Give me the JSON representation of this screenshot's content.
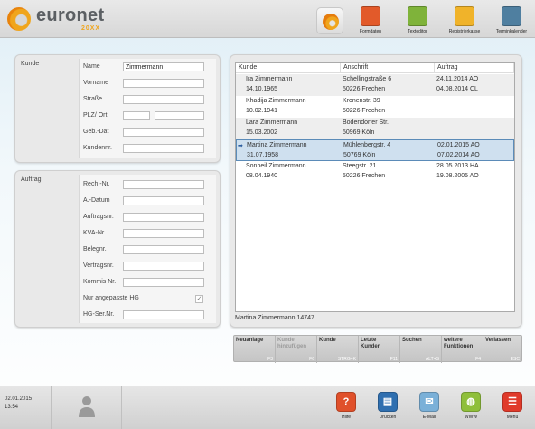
{
  "app": {
    "brand": "euronet",
    "brand_sub": "20XX"
  },
  "toolbar": [
    {
      "label": "Formdaten",
      "icon": "glasses-icon",
      "color": "#e25a2a"
    },
    {
      "label": "Texteditor",
      "icon": "pencil-icon",
      "color": "#7fb33a"
    },
    {
      "label": "Registrierkasse",
      "icon": "cash-register-icon",
      "color": "#f0b32a"
    },
    {
      "label": "Terminkalender",
      "icon": "calendar-icon",
      "color": "#4f7fa0"
    }
  ],
  "kunde": {
    "title": "Kunde",
    "fields": [
      {
        "label": "Name",
        "value": "Zimmermann"
      },
      {
        "label": "Vorname",
        "value": ""
      },
      {
        "label": "Straße",
        "value": ""
      },
      {
        "label": "PLZ/ Ort",
        "value": "",
        "value2": ""
      },
      {
        "label": "Geb.-Dat",
        "value": ""
      },
      {
        "label": "Kundennr.",
        "value": ""
      }
    ]
  },
  "auftrag": {
    "title": "Auftrag",
    "fields": [
      {
        "label": "Rech.-Nr.",
        "value": ""
      },
      {
        "label": "A.-Datum",
        "value": ""
      },
      {
        "label": "Auftragsnr.",
        "value": ""
      },
      {
        "label": "KVA-Nr.",
        "value": ""
      },
      {
        "label": "Belegnr.",
        "value": ""
      },
      {
        "label": "Vertragsnr.",
        "value": ""
      },
      {
        "label": "Kommis Nr.",
        "value": ""
      },
      {
        "label": "Nur angepasste HG",
        "checked": true
      },
      {
        "label": "HG-Ser.Nr.",
        "value": ""
      }
    ]
  },
  "table": {
    "headers": [
      "Kunde",
      "Anschrift",
      "Auftrag"
    ],
    "rows": [
      {
        "name": "Ira Zimmermann",
        "dob": "14.10.1965",
        "street": "Schellingstraße 6",
        "city": "50226 Frechen",
        "order1": "24.11.2014 AO",
        "order2": "04.08.2014 CL"
      },
      {
        "name": "Khadija Zimmermann",
        "dob": "10.02.1941",
        "street": "Kronenstr. 39",
        "city": "50226 Frechen",
        "order1": "",
        "order2": ""
      },
      {
        "name": "Lara Zimmermann",
        "dob": "15.03.2002",
        "street": "Bodendorfer Str.",
        "city": "50969 Köln",
        "order1": "",
        "order2": ""
      },
      {
        "name": "Martina Zimmermann",
        "dob": "31.07.1958",
        "street": "Mühlenbergstr. 4",
        "city": "50769 Köln",
        "order1": "02.01.2015 AO",
        "order2": "07.02.2014 AO",
        "selected": true
      },
      {
        "name": "Sonheil Zimmermann",
        "dob": "08.04.1940",
        "street": "Steegstr. 21",
        "city": "50226 Frechen",
        "order1": "28.05.2013 HA",
        "order2": "19.08.2005 AO"
      }
    ],
    "status": "Martina Zimmermann 14747"
  },
  "fkeys": [
    {
      "label": "Neuanlage",
      "key": "F3",
      "enabled": true
    },
    {
      "label": "Kunde\nhinzufügen",
      "key": "F6",
      "enabled": false
    },
    {
      "label": "Kunde",
      "key": "STRG+K",
      "enabled": true
    },
    {
      "label": "Letzte\nKunden",
      "key": "F11",
      "enabled": true
    },
    {
      "label": "Suchen",
      "key": "ALT+S",
      "enabled": true
    },
    {
      "label": "weitere\nFunktionen",
      "key": "F4",
      "enabled": true
    },
    {
      "label": "Verlassen",
      "key": "ESC",
      "enabled": true
    }
  ],
  "footer": {
    "date": "02.01.2015",
    "time": "13:54",
    "buttons": [
      {
        "label": "Hilfe",
        "icon": "help-icon",
        "glyph": "?",
        "color": "#e0502a"
      },
      {
        "label": "Drucken",
        "icon": "printer-icon",
        "glyph": "▤",
        "color": "#2f6fb0"
      },
      {
        "label": "E-Mail",
        "icon": "mail-icon",
        "glyph": "✉",
        "color": "#7ab0d8"
      },
      {
        "label": "WWW",
        "icon": "globe-icon",
        "glyph": "◍",
        "color": "#8fbf3a"
      },
      {
        "label": "Menü",
        "icon": "menu-icon",
        "glyph": "☰",
        "color": "#e03a2a"
      }
    ]
  }
}
